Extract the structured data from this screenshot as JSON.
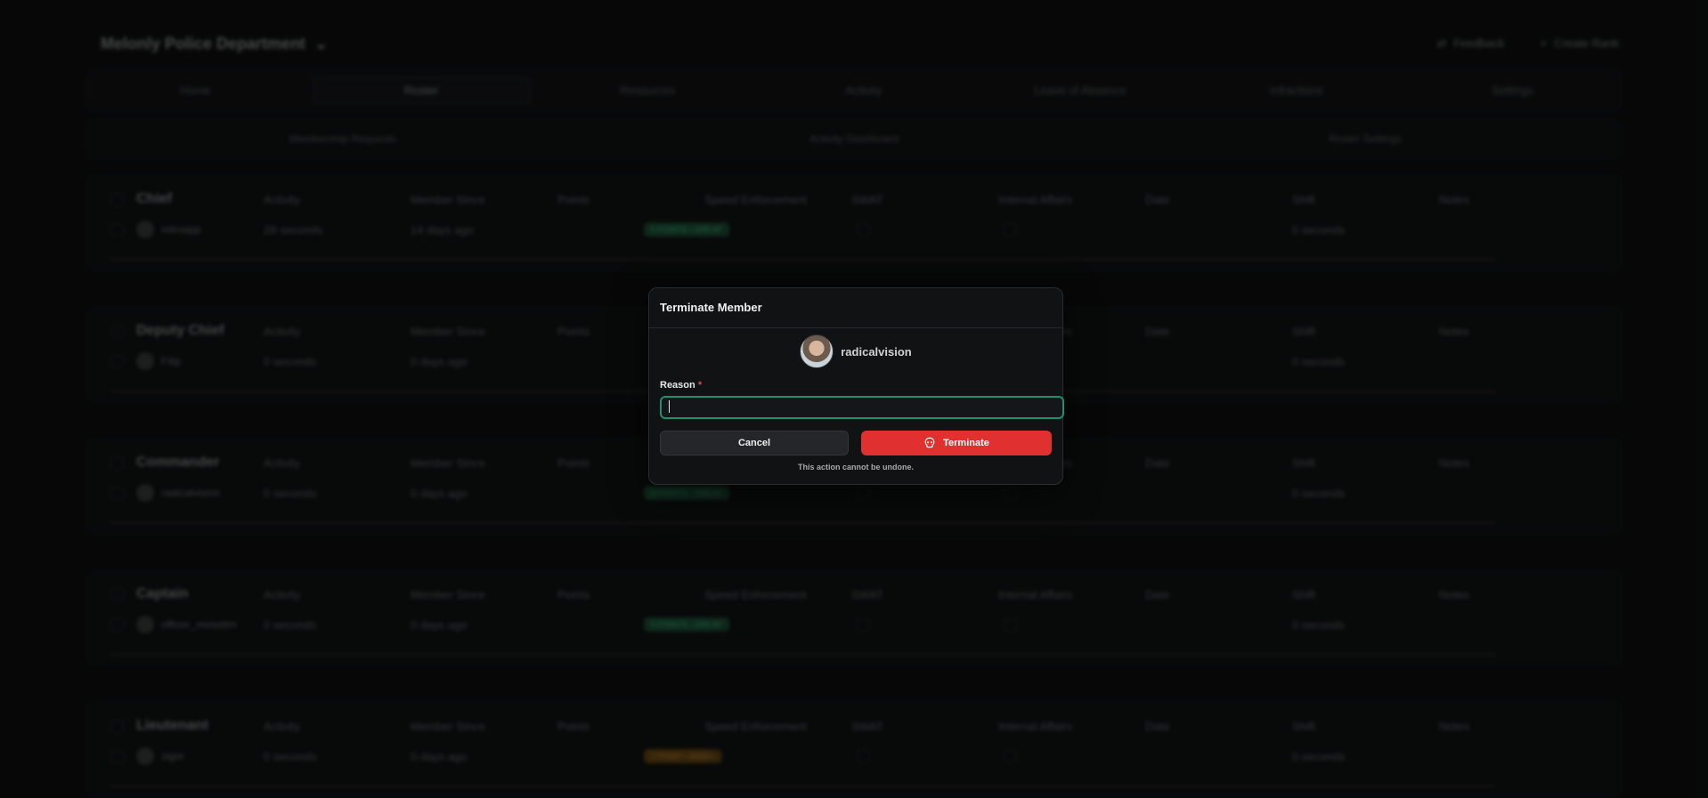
{
  "background": {
    "department": "Melonly Police Department",
    "actions": [
      {
        "icon": "feedback-icon",
        "label": "Feedback"
      },
      {
        "icon": "plus-icon",
        "label": "Create Rank"
      }
    ],
    "tabs": [
      "Home",
      "Roster",
      "Resources",
      "Activity",
      "Leave of Absence",
      "Infractions",
      "Settings"
    ],
    "active_tab": "Roster",
    "subtabs": [
      "Membership Requests",
      "Activity Dashboard",
      "Roster Settings"
    ],
    "columns": [
      "Activity",
      "Member Since",
      "Points",
      "Speed Enforcement",
      "SWAT",
      "Internal Affairs",
      "Date",
      "Shift",
      "Notes"
    ],
    "ranks": [
      {
        "name": "Chief",
        "member": "retroapp",
        "activity": "28 seconds",
        "since": "14 days ago",
        "points": "0 POINTS • GREAT",
        "badge": "green",
        "shift": "0 seconds"
      },
      {
        "name": "Deputy Chief",
        "member": "Filip",
        "activity": "0 seconds",
        "since": "0 days ago",
        "points": "",
        "badge": "none",
        "shift": "0 seconds"
      },
      {
        "name": "Commander",
        "member": "radicalvision",
        "activity": "0 seconds",
        "since": "0 days ago",
        "points": "0 POINTS • GREAT",
        "badge": "green",
        "shift": "0 seconds"
      },
      {
        "name": "Captain",
        "member": "officer_mossttm",
        "activity": "0 seconds",
        "since": "0 days ago",
        "points": "0 POINTS • GREAT",
        "badge": "green",
        "shift": "0 seconds"
      },
      {
        "name": "Lieutenant",
        "member": "ziger",
        "activity": "0 seconds",
        "since": "0 days ago",
        "points": "1 POINT • GOOD",
        "badge": "orange",
        "shift": "0 seconds"
      }
    ]
  },
  "modal": {
    "title": "Terminate Member",
    "username": "radicalvision",
    "reason_label": "Reason",
    "required_mark": "*",
    "reason_value": "",
    "cancel_label": "Cancel",
    "terminate_label": "Terminate",
    "terminate_icon": "skull-icon",
    "warning": "This action cannot be undone."
  },
  "colors": {
    "accent_focus": "#1f8f6e",
    "danger": "#e03030",
    "badge_green": "#1d6b45",
    "badge_orange": "#8a5a12"
  }
}
